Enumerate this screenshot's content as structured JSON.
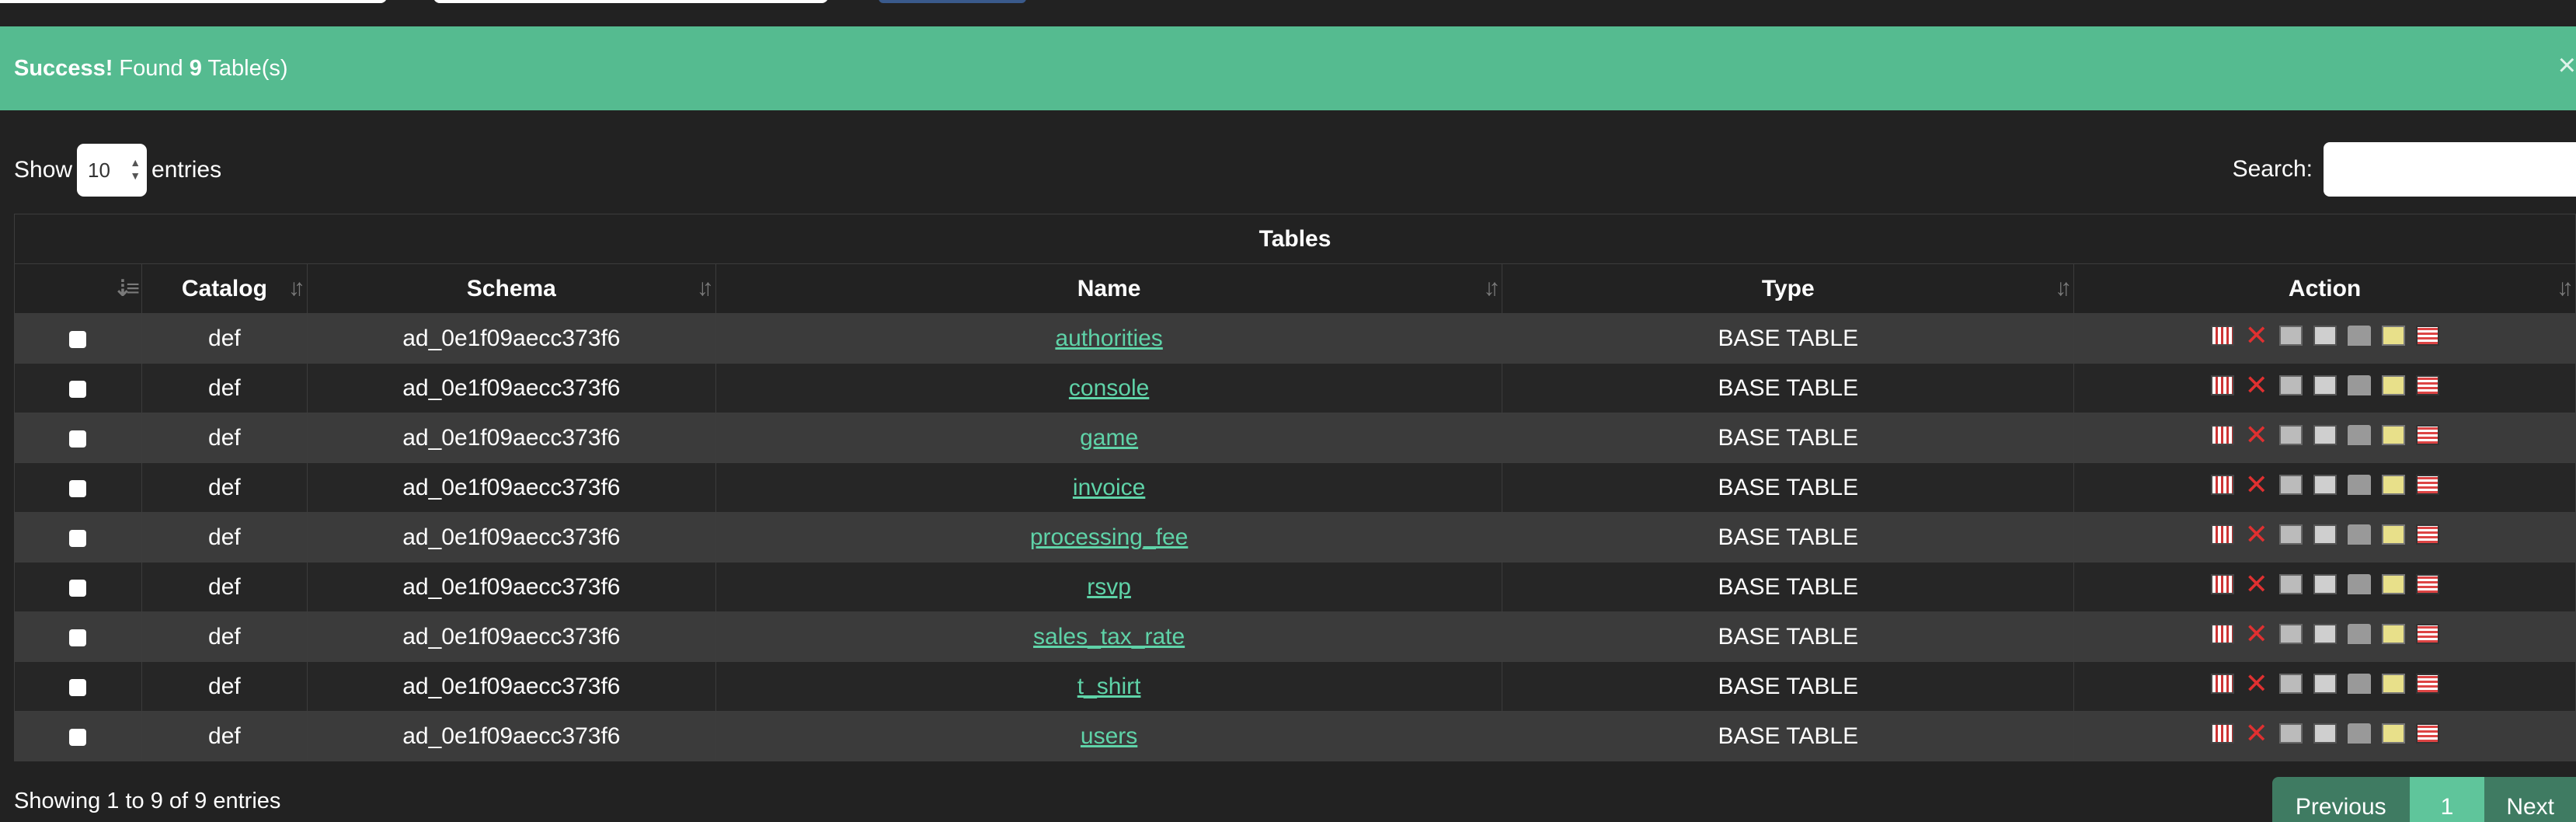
{
  "alert": {
    "strong": "Success!",
    "pre": " Found ",
    "count": "9",
    "post": " Table(s)",
    "close": "×"
  },
  "length": {
    "show_label": "Show",
    "selected": "10",
    "entries_label": "entries"
  },
  "search": {
    "label": "Search:",
    "placeholder": ""
  },
  "table": {
    "caption": "Tables",
    "headers": [
      "Catalog",
      "Schema",
      "Name",
      "Type",
      "Action"
    ],
    "rows": [
      {
        "catalog": "def",
        "schema": "ad_0e1f09aecc373f6",
        "name": "authorities",
        "type": "BASE TABLE"
      },
      {
        "catalog": "def",
        "schema": "ad_0e1f09aecc373f6",
        "name": "console",
        "type": "BASE TABLE"
      },
      {
        "catalog": "def",
        "schema": "ad_0e1f09aecc373f6",
        "name": "game",
        "type": "BASE TABLE"
      },
      {
        "catalog": "def",
        "schema": "ad_0e1f09aecc373f6",
        "name": "invoice",
        "type": "BASE TABLE"
      },
      {
        "catalog": "def",
        "schema": "ad_0e1f09aecc373f6",
        "name": "processing_fee",
        "type": "BASE TABLE"
      },
      {
        "catalog": "def",
        "schema": "ad_0e1f09aecc373f6",
        "name": "rsvp",
        "type": "BASE TABLE"
      },
      {
        "catalog": "def",
        "schema": "ad_0e1f09aecc373f6",
        "name": "sales_tax_rate",
        "type": "BASE TABLE"
      },
      {
        "catalog": "def",
        "schema": "ad_0e1f09aecc373f6",
        "name": "t_shirt",
        "type": "BASE TABLE"
      },
      {
        "catalog": "def",
        "schema": "ad_0e1f09aecc373f6",
        "name": "users",
        "type": "BASE TABLE"
      }
    ],
    "action_icons": [
      "browse-icon",
      "drop-icon",
      "structure-icon",
      "search-icon",
      "insert-icon",
      "empty-icon",
      "export-icon"
    ]
  },
  "footer": {
    "info": "Showing 1 to 9 of 9 entries",
    "previous": "Previous",
    "page": "1",
    "next": "Next"
  },
  "colors": {
    "background": "#222222",
    "alert": "#55bb90",
    "link": "#5fd3a8",
    "pager": "#3f7b62"
  }
}
